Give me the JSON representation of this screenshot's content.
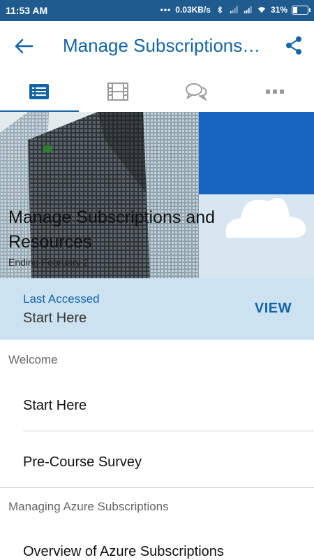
{
  "status_bar": {
    "time": "11:53 AM",
    "speed": "0.03KB/s",
    "battery": "31%",
    "battery_level": 0.31
  },
  "app_bar": {
    "title": "Manage Subscriptions…",
    "back_icon": "arrow-left-icon",
    "share_icon": "share-icon"
  },
  "tabs": [
    {
      "icon": "list-icon",
      "active": true
    },
    {
      "icon": "film-icon",
      "active": false
    },
    {
      "icon": "chat-bubbles-icon",
      "active": false
    },
    {
      "icon": "more-dots-icon",
      "active": false
    }
  ],
  "hero": {
    "title": "Manage Subscriptions and Resources",
    "subtitle": "Ending February 2"
  },
  "last_accessed": {
    "label": "Last Accessed",
    "value": "Start Here",
    "view_label": "VIEW"
  },
  "sections": [
    {
      "heading": "Welcome",
      "items": [
        "Start Here",
        "Pre-Course Survey"
      ]
    },
    {
      "heading": "Managing Azure Subscriptions",
      "items": [
        "Overview of Azure Subscriptions"
      ]
    }
  ],
  "colors": {
    "accent": "#1565a6",
    "status_bar": "#1f5b8f",
    "highlight_bg": "#cde2f0"
  }
}
